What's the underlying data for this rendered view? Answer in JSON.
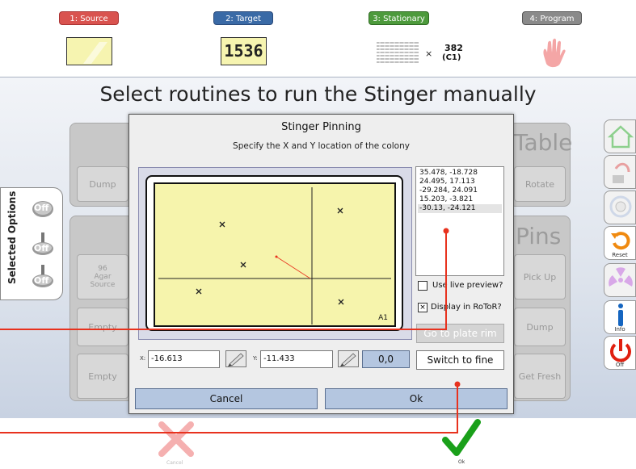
{
  "steps": [
    {
      "label": "1: Source",
      "color": "#d9534f"
    },
    {
      "label": "2: Target",
      "color": "#3a6aa6"
    },
    {
      "label": "3: Stationary",
      "color": "#4d9a3c"
    },
    {
      "label": "4: Program",
      "color": "#777777"
    }
  ],
  "target_number": "1536",
  "stationary_count": "382",
  "stationary_sub": "(C1)",
  "stationary_times": "×",
  "main_title": "Select routines to run the Stinger manually",
  "background_buttons": {
    "dump_left": "Dump",
    "agar_source": "96\nAgar\nSource",
    "empty1": "Empty",
    "empty2": "Empty",
    "table_word": "Table",
    "rotate": "Rotate",
    "pins_word": "Pins",
    "pick_up": "Pick Up",
    "dump_right": "Dump",
    "get_fresh": "Get Fresh"
  },
  "selected_options": {
    "title": "Selected Options",
    "off1": "Off",
    "off2": "Off",
    "off3": "Off"
  },
  "tools": {
    "reset": "Reset",
    "info": "Info",
    "off": "Off"
  },
  "dialog": {
    "title": "Stinger Pinning",
    "subtitle": "Specify the X and Y location of the colony",
    "plate_label": "A1",
    "coords": [
      "35.478, -18.728",
      "24.495, 17.113",
      "-29.284, 24.091",
      "15.203, -3.821",
      "-30.13, -24.121"
    ],
    "selected_index": 4,
    "use_live_preview": "Use live preview?",
    "display_in_rotor": "Display in RoToR?",
    "go_to_plate_rim": "Go to plate rim",
    "x_label": "X:",
    "x_value": "-16.613",
    "y_label": "Y:",
    "y_value": "-11.433",
    "origin_button": "0,0",
    "switch_button": "Switch to fine",
    "cancel": "Cancel",
    "ok": "Ok"
  },
  "bottom": {
    "cancel_label": "Cancel",
    "ok_label": "Ok"
  },
  "colors": {
    "annotation_red": "#e8321e",
    "check_green": "#1aa01a",
    "cancel_x": "#f5b0b0"
  }
}
